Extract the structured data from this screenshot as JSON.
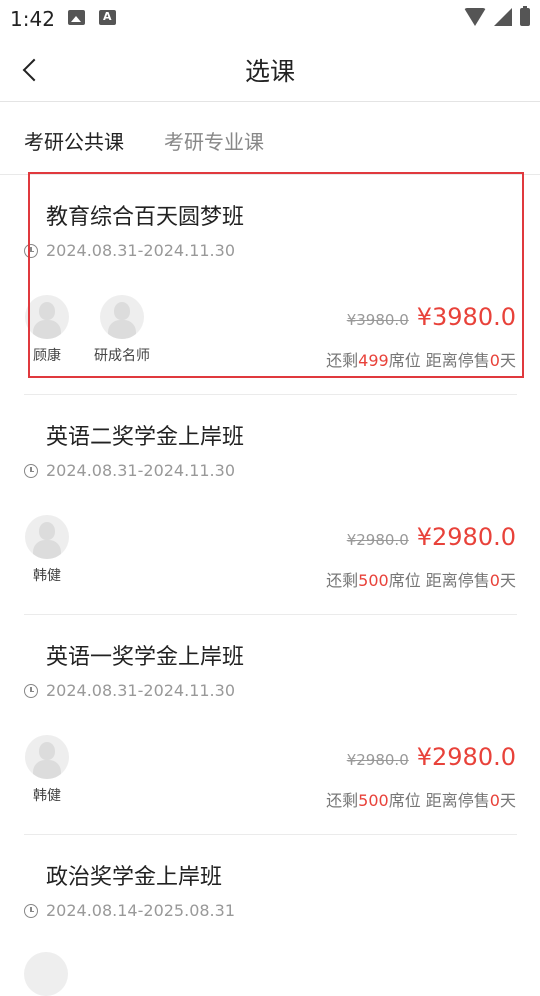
{
  "status_bar": {
    "time": "1:42",
    "left_icons": [
      "image-icon",
      "a-icon"
    ],
    "right_icons": [
      "wifi-icon",
      "signal-icon",
      "battery-icon"
    ]
  },
  "header": {
    "title": "选课"
  },
  "tabs": [
    {
      "label": "考研公共课",
      "active": true
    },
    {
      "label": "考研专业课",
      "active": false
    }
  ],
  "colors": {
    "accent": "#e8423a",
    "highlight_border": "#e0393e"
  },
  "courses": [
    {
      "name": "教育综合百天圆梦班",
      "date": "2024.08.31-2024.11.30",
      "teachers": [
        "顾康",
        "研成名师"
      ],
      "original_price": "¥3980.0",
      "price": "¥3980.0",
      "seats_prefix": "还剩",
      "seats": "499",
      "seats_mid": "席位 距离停售",
      "days": "0",
      "days_suffix": "天"
    },
    {
      "name": "英语二奖学金上岸班",
      "date": "2024.08.31-2024.11.30",
      "teachers": [
        "韩健"
      ],
      "original_price": "¥2980.0",
      "price": "¥2980.0",
      "seats_prefix": "还剩",
      "seats": "500",
      "seats_mid": "席位 距离停售",
      "days": "0",
      "days_suffix": "天"
    },
    {
      "name": "英语一奖学金上岸班",
      "date": "2024.08.31-2024.11.30",
      "teachers": [
        "韩健"
      ],
      "original_price": "¥2980.0",
      "price": "¥2980.0",
      "seats_prefix": "还剩",
      "seats": "500",
      "seats_mid": "席位 距离停售",
      "days": "0",
      "days_suffix": "天"
    },
    {
      "name": "政治奖学金上岸班",
      "date": "2024.08.14-2025.08.31"
    }
  ]
}
